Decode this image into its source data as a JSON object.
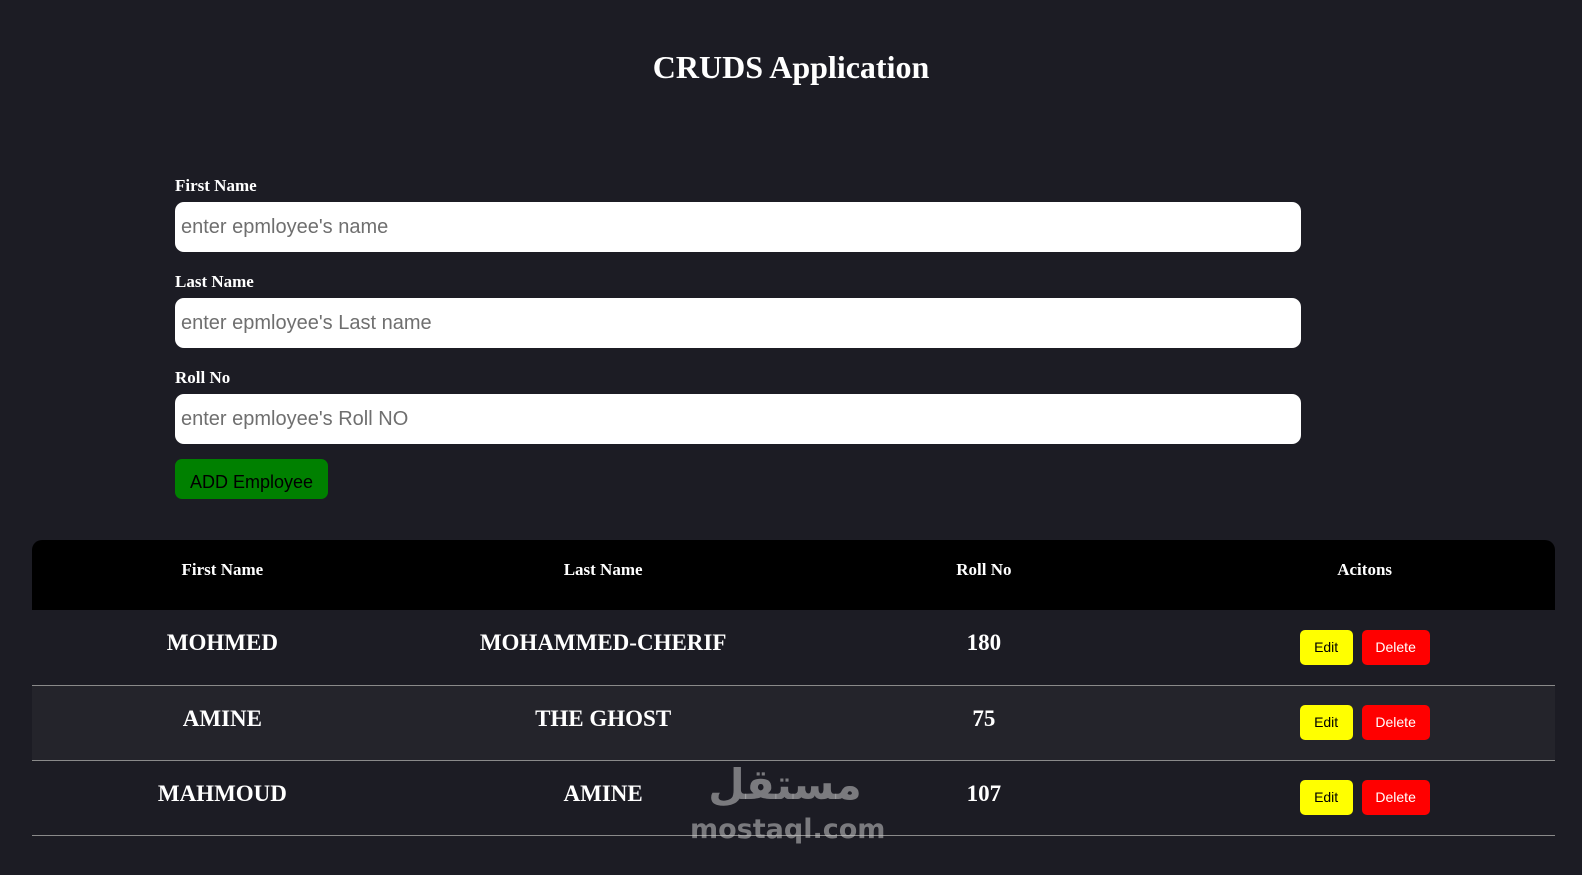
{
  "page": {
    "title": "CRUDS Application"
  },
  "form": {
    "first_name": {
      "label": "First Name",
      "placeholder": "enter epmloyee's name",
      "value": ""
    },
    "last_name": {
      "label": "Last Name",
      "placeholder": "enter epmloyee's Last name",
      "value": ""
    },
    "roll_no": {
      "label": "Roll No",
      "placeholder": "enter epmloyee's Roll NO",
      "value": ""
    },
    "add_button_label": "ADD Employee"
  },
  "table": {
    "headers": [
      "First Name",
      "Last Name",
      "Roll No",
      "Acitons"
    ],
    "rows": [
      {
        "first_name": "MOHMED",
        "last_name": "MOHAMMED-CHERIF",
        "roll_no": "180"
      },
      {
        "first_name": "AMINE",
        "last_name": "THE GHOST",
        "roll_no": "75"
      },
      {
        "first_name": "MAHMOUD",
        "last_name": "AMINE",
        "roll_no": "107"
      }
    ],
    "edit_label": "Edit",
    "delete_label": "Delete"
  },
  "watermark": {
    "arabic": "مستقل",
    "latin": "mostaql.com"
  },
  "colors": {
    "background": "#1c1c24",
    "add_button": "#008000",
    "edit_button": "#ffff00",
    "delete_button": "#ff0000",
    "table_header": "#000000"
  }
}
